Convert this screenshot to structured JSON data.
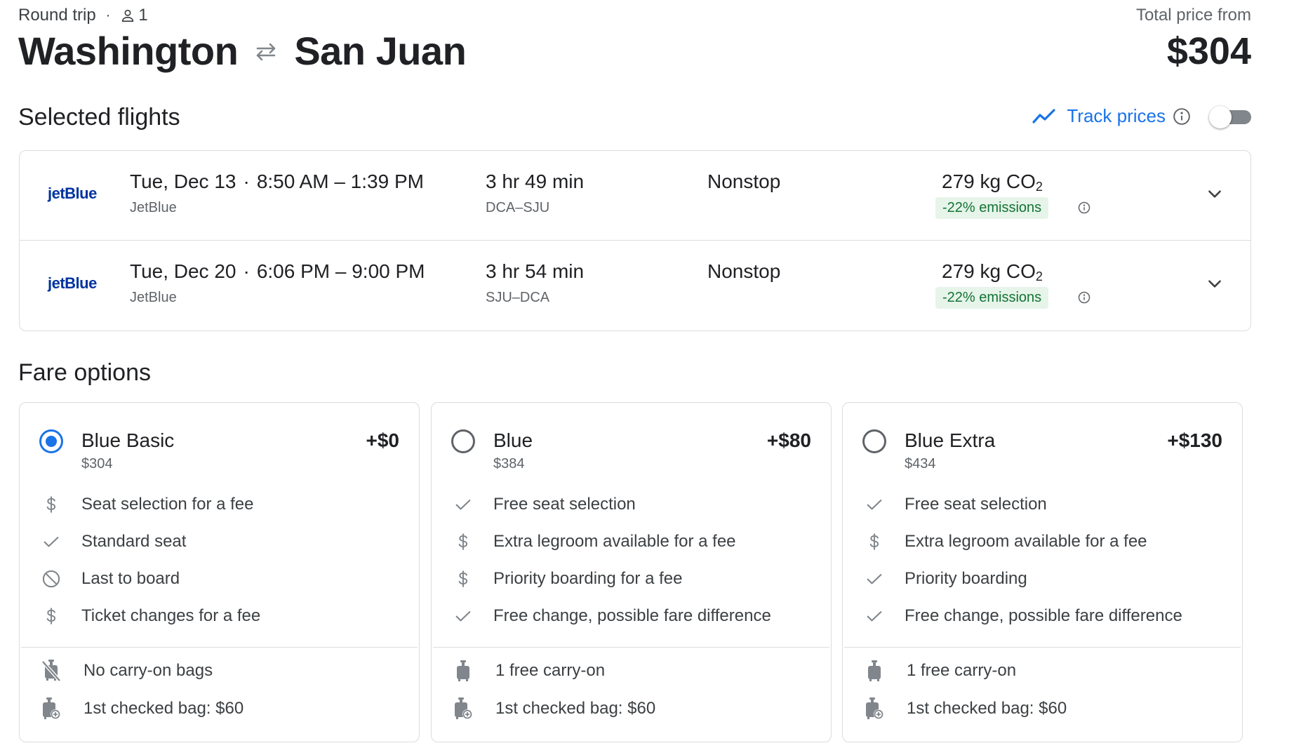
{
  "header": {
    "trip_type": "Round trip",
    "passengers": "1",
    "origin": "Washington",
    "destination": "San Juan",
    "total_label": "Total price from",
    "total_price": "$304"
  },
  "selected_flights": {
    "title": "Selected flights",
    "track_label": "Track prices",
    "track_enabled": false,
    "flights": [
      {
        "logo": "jetBlue",
        "date": "Tue, Dec 13",
        "times": "8:50 AM – 1:39 PM",
        "airline": "JetBlue",
        "duration": "3 hr 49 min",
        "airports": "DCA–SJU",
        "stops": "Nonstop",
        "co2": "279 kg CO",
        "co2_sub": "2",
        "emissions": "-22% emissions"
      },
      {
        "logo": "jetBlue",
        "date": "Tue, Dec 20",
        "times": "6:06 PM – 9:00 PM",
        "airline": "JetBlue",
        "duration": "3 hr 54 min",
        "airports": "SJU–DCA",
        "stops": "Nonstop",
        "co2": "279 kg CO",
        "co2_sub": "2",
        "emissions": "-22% emissions"
      }
    ]
  },
  "fare_options": {
    "title": "Fare options",
    "fares": [
      {
        "name": "Blue Basic",
        "price": "$304",
        "add": "+$0",
        "selected": true,
        "features": [
          {
            "icon": "dollar-icon",
            "text": "Seat selection for a fee"
          },
          {
            "icon": "check-icon",
            "text": "Standard seat"
          },
          {
            "icon": "block-icon",
            "text": "Last to board"
          },
          {
            "icon": "dollar-icon",
            "text": "Ticket changes for a fee"
          }
        ],
        "bags": [
          {
            "icon": "no-carry-on-icon",
            "text": "No carry-on bags"
          },
          {
            "icon": "checked-bag-icon",
            "text": "1st checked bag: $60"
          }
        ]
      },
      {
        "name": "Blue",
        "price": "$384",
        "add": "+$80",
        "selected": false,
        "features": [
          {
            "icon": "check-icon",
            "text": "Free seat selection"
          },
          {
            "icon": "dollar-icon",
            "text": "Extra legroom available for a fee"
          },
          {
            "icon": "dollar-icon",
            "text": "Priority boarding for a fee"
          },
          {
            "icon": "check-icon",
            "text": "Free change, possible fare difference"
          }
        ],
        "bags": [
          {
            "icon": "carry-on-icon",
            "text": "1 free carry-on"
          },
          {
            "icon": "checked-bag-icon",
            "text": "1st checked bag: $60"
          }
        ]
      },
      {
        "name": "Blue Extra",
        "price": "$434",
        "add": "+$130",
        "selected": false,
        "features": [
          {
            "icon": "check-icon",
            "text": "Free seat selection"
          },
          {
            "icon": "dollar-icon",
            "text": "Extra legroom available for a fee"
          },
          {
            "icon": "check-icon",
            "text": "Priority boarding"
          },
          {
            "icon": "check-icon",
            "text": "Free change, possible fare difference"
          }
        ],
        "bags": [
          {
            "icon": "carry-on-icon",
            "text": "1 free carry-on"
          },
          {
            "icon": "checked-bag-icon",
            "text": "1st checked bag: $60"
          }
        ]
      }
    ]
  },
  "colors": {
    "accent": "#1a73e8",
    "emissions_bg": "#e6f4ea",
    "emissions_text": "#137333",
    "brand": "#0033a0"
  }
}
